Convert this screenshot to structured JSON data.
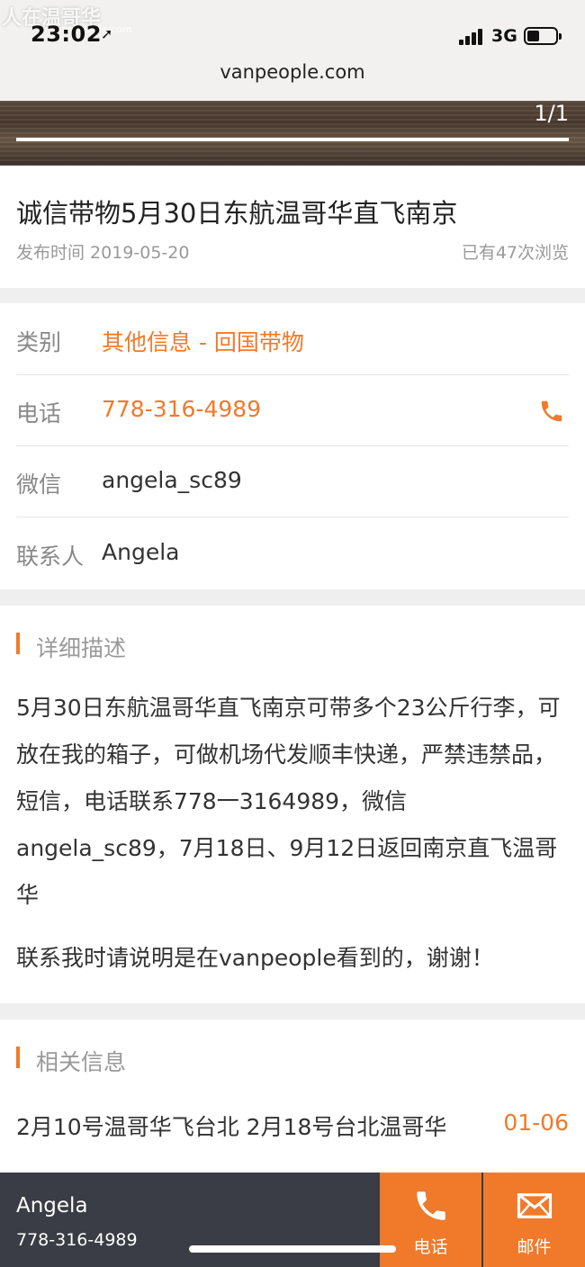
{
  "status_bar": {
    "time": "23:02",
    "network": "3G",
    "watermark": "人在温哥华",
    "watermark_sub": "vanpeople.com"
  },
  "browser": {
    "url": "vanpeople.com"
  },
  "banner": {
    "pager": "1/1"
  },
  "post": {
    "title": "诚信带物5月30日东航温哥华直飞南京",
    "publish_label": "发布时间 2019-05-20",
    "views_label": "已有47次浏览"
  },
  "info": {
    "category_label": "类别",
    "category_value": "其他信息 - 回国带物",
    "phone_label": "电话",
    "phone_value": "778-316-4989",
    "wechat_label": "微信",
    "wechat_value": "angela_sc89",
    "contact_label": "联系人",
    "contact_value": "Angela"
  },
  "description": {
    "heading": "详细描述",
    "body": "5月30日东航温哥华直飞南京可带多个23公斤行李，可放在我的箱子，可做机场代发顺丰快递，严禁违禁品，短信，电话联系778一3164989，微信angela_sc89，7月18日、9月12日返回南京直飞温哥华",
    "footer": "联系我时请说明是在vanpeople看到的，谢谢！"
  },
  "related": {
    "heading": "相关信息",
    "items": [
      {
        "title": "2月10号温哥华飞台北 2月18号台北温哥华",
        "date": "01-06"
      }
    ]
  },
  "bottom_bar": {
    "name": "Angela",
    "phone": "778-316-4989",
    "call_label": "电话",
    "mail_label": "邮件"
  },
  "colors": {
    "accent": "#f07a2a",
    "dark_bar": "#3a3d45"
  }
}
